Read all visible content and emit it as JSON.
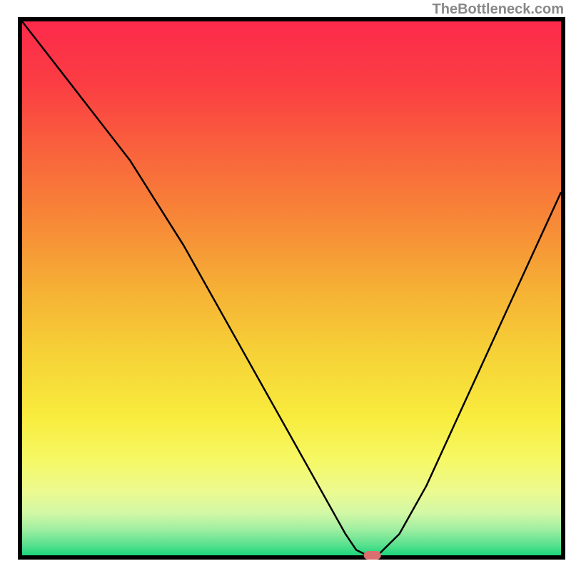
{
  "watermark": "TheBottleneck.com",
  "chart_data": {
    "type": "line",
    "title": "",
    "xlabel": "",
    "ylabel": "",
    "xlim": [
      0,
      100
    ],
    "ylim": [
      0,
      100
    ],
    "grid": false,
    "axes": {
      "left": true,
      "bottom": true,
      "top": false,
      "right": false
    },
    "series": [
      {
        "name": "bottleneck-curve",
        "color": "#000000",
        "x": [
          0,
          10,
          20,
          30,
          40,
          50,
          55,
          60,
          62,
          64,
          66,
          70,
          75,
          80,
          85,
          90,
          100
        ],
        "values": [
          100,
          87,
          74,
          58,
          40,
          22,
          13,
          4,
          1,
          0,
          0,
          4,
          13,
          24,
          35,
          46,
          68
        ]
      }
    ],
    "marker": {
      "name": "optimal-point",
      "x": 65,
      "y": 0,
      "color": "#d9706f",
      "shape": "pill"
    },
    "background_gradient": {
      "stops": [
        {
          "offset": 0.0,
          "color": "#fc2a4b"
        },
        {
          "offset": 0.12,
          "color": "#fb3e43"
        },
        {
          "offset": 0.25,
          "color": "#f9653c"
        },
        {
          "offset": 0.38,
          "color": "#f78a37"
        },
        {
          "offset": 0.5,
          "color": "#f6b035"
        },
        {
          "offset": 0.62,
          "color": "#f6d137"
        },
        {
          "offset": 0.74,
          "color": "#f8ec3d"
        },
        {
          "offset": 0.82,
          "color": "#f6f864"
        },
        {
          "offset": 0.88,
          "color": "#ecfa8f"
        },
        {
          "offset": 0.92,
          "color": "#d3f8a5"
        },
        {
          "offset": 0.95,
          "color": "#a3efa2"
        },
        {
          "offset": 0.98,
          "color": "#5ae18f"
        },
        {
          "offset": 1.0,
          "color": "#1cd67b"
        }
      ]
    }
  }
}
